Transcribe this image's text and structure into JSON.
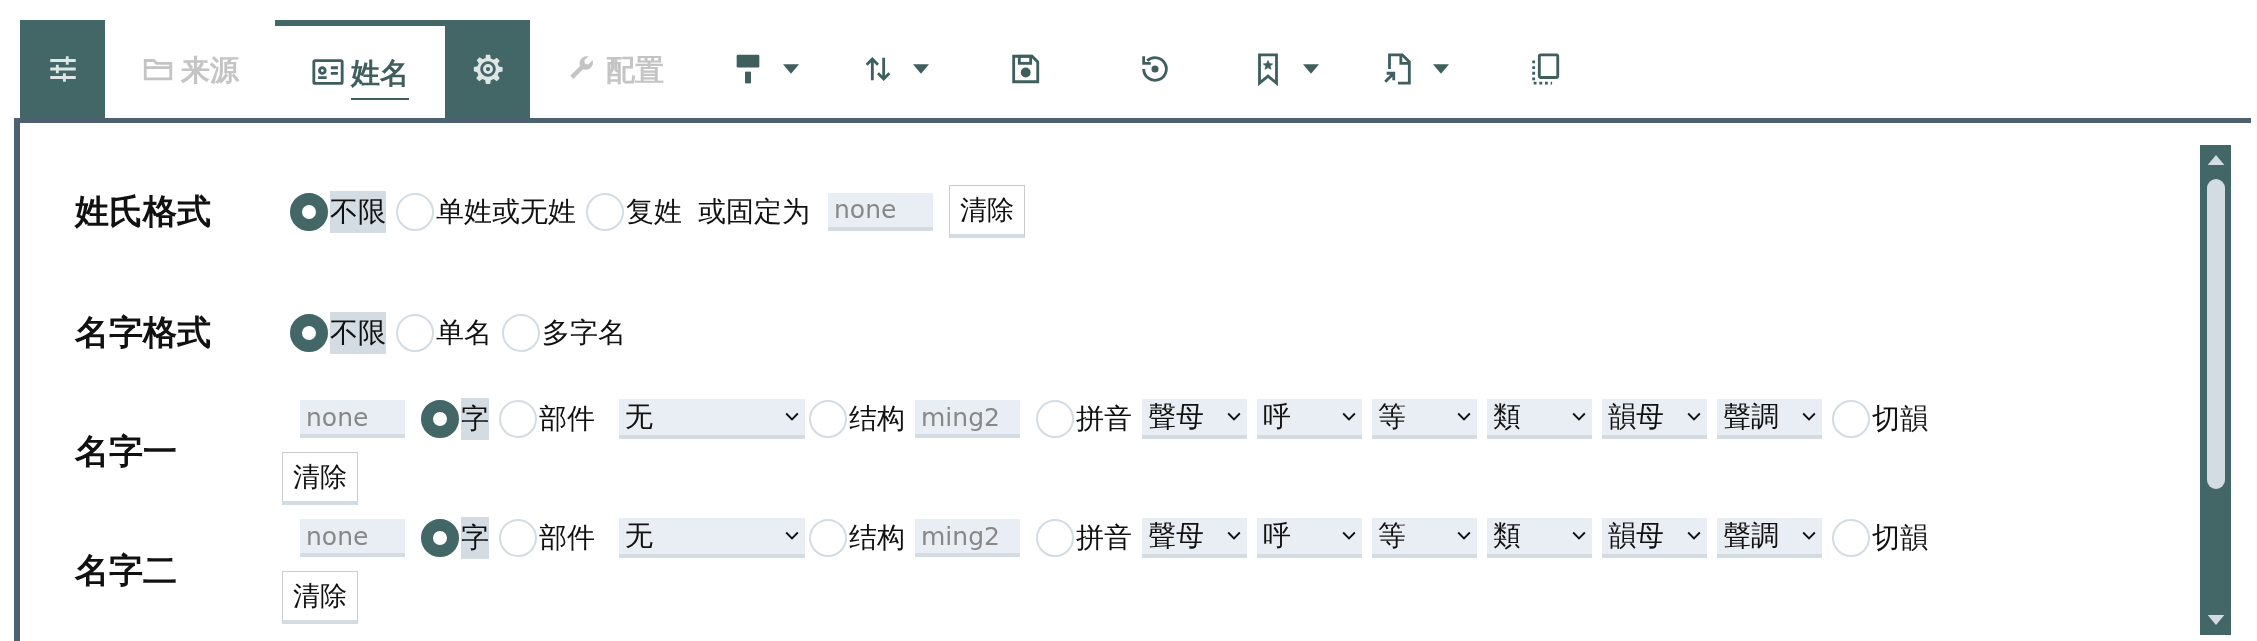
{
  "toolbar": [
    {
      "kind": "box"
    },
    {
      "kind": "tab",
      "label": "来源",
      "selected": false,
      "disabled": true
    },
    {
      "kind": "tab",
      "label": "姓名",
      "selected": true,
      "disabled": false
    },
    {
      "kind": "box"
    },
    {
      "kind": "tab",
      "label": "配置",
      "selected": false,
      "disabled": true
    },
    {
      "kind": "tool",
      "dropdown": true
    },
    {
      "kind": "tool",
      "dropdown": true
    },
    {
      "kind": "tool",
      "dropdown": false
    },
    {
      "kind": "tool",
      "dropdown": false
    },
    {
      "kind": "tool",
      "dropdown": true
    },
    {
      "kind": "tool",
      "dropdown": true
    },
    {
      "kind": "tool",
      "dropdown": false
    }
  ],
  "rows": [
    {
      "label": "姓氏格式",
      "controls": [
        {
          "kind": "radio",
          "label": "不限",
          "selected": true
        },
        {
          "kind": "radio",
          "label": "单姓或无姓",
          "selected": false
        },
        {
          "kind": "radio",
          "label": "复姓",
          "selected": false
        },
        {
          "kind": "text",
          "label": "或固定为"
        },
        {
          "kind": "input",
          "placeholder": "none"
        },
        {
          "kind": "button",
          "label": "清除"
        }
      ]
    },
    {
      "label": "名字格式",
      "controls": [
        {
          "kind": "radio",
          "label": "不限",
          "selected": true
        },
        {
          "kind": "radio",
          "label": "单名",
          "selected": false
        },
        {
          "kind": "radio",
          "label": "多字名",
          "selected": false
        }
      ]
    },
    {
      "label": "名字一",
      "controls": [
        {
          "kind": "input",
          "placeholder": "none"
        },
        {
          "kind": "radio",
          "label": "字",
          "selected": true
        },
        {
          "kind": "radio",
          "label": "部件",
          "selected": false
        },
        {
          "kind": "select",
          "value": "无"
        },
        {
          "kind": "radio",
          "label": "结构",
          "selected": false
        },
        {
          "kind": "input",
          "placeholder": "ming2"
        },
        {
          "kind": "radio",
          "label": "拼音",
          "selected": false
        },
        {
          "kind": "select",
          "value": "聲母"
        },
        {
          "kind": "select",
          "value": "呼"
        },
        {
          "kind": "select",
          "value": "等"
        },
        {
          "kind": "select",
          "value": "類"
        },
        {
          "kind": "select",
          "value": "韻母"
        },
        {
          "kind": "select",
          "value": "聲調"
        },
        {
          "kind": "radio",
          "label": "切韻",
          "selected": false
        }
      ],
      "second_line": [
        {
          "kind": "button",
          "label": "清除"
        }
      ]
    },
    {
      "label": "名字二",
      "controls": [
        {
          "kind": "input",
          "placeholder": "none"
        },
        {
          "kind": "radio",
          "label": "字",
          "selected": true
        },
        {
          "kind": "radio",
          "label": "部件",
          "selected": false
        },
        {
          "kind": "select",
          "value": "无"
        },
        {
          "kind": "radio",
          "label": "结构",
          "selected": false
        },
        {
          "kind": "input",
          "placeholder": "ming2"
        },
        {
          "kind": "radio",
          "label": "拼音",
          "selected": false
        },
        {
          "kind": "select",
          "value": "聲母"
        },
        {
          "kind": "select",
          "value": "呼"
        },
        {
          "kind": "select",
          "value": "等"
        },
        {
          "kind": "select",
          "value": "類"
        },
        {
          "kind": "select",
          "value": "韻母"
        },
        {
          "kind": "select",
          "value": "聲調"
        },
        {
          "kind": "radio",
          "label": "切韻",
          "selected": false
        }
      ],
      "second_line": [
        {
          "kind": "button",
          "label": "清除"
        }
      ]
    }
  ]
}
